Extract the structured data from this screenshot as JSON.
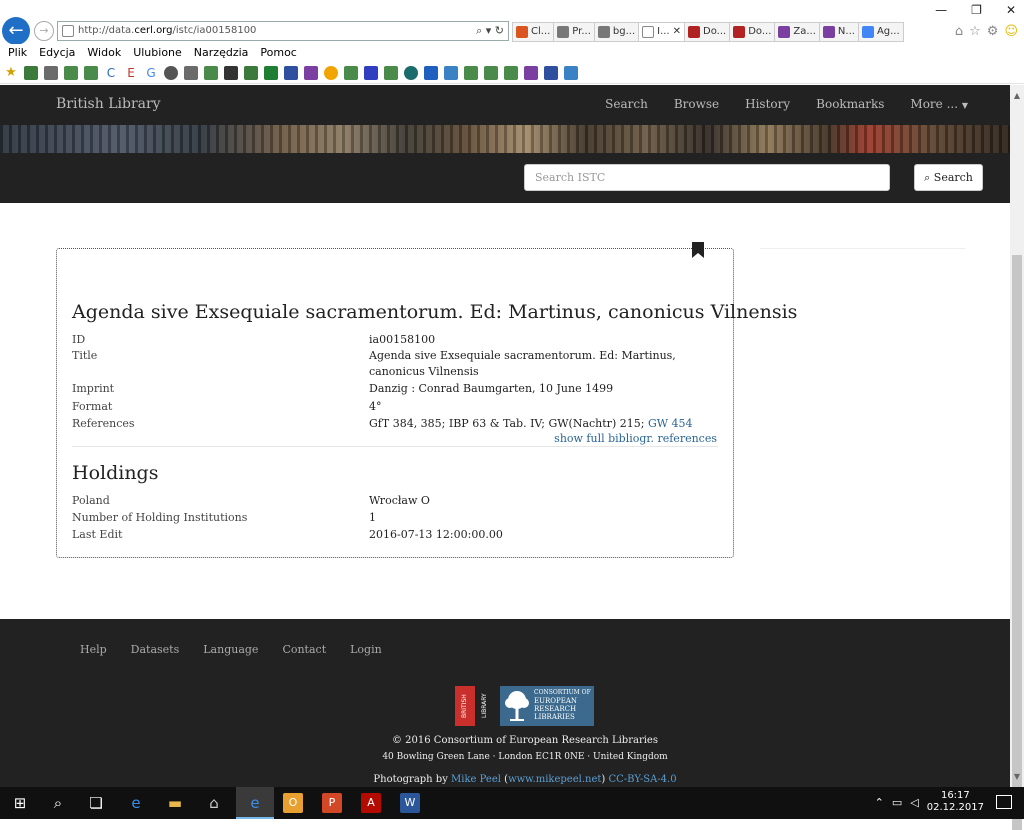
{
  "browser": {
    "url_prefix": "http://data.",
    "url_host": "cerl.org",
    "url_path": "/istc/ia00158100",
    "tabs": [
      {
        "label": "Cl...",
        "color": "#d9541e"
      },
      {
        "label": "Pr...",
        "color": "#777777"
      },
      {
        "label": "bg...",
        "color": "#777777"
      },
      {
        "label": "I...",
        "color": "#888888",
        "active": true
      },
      {
        "label": "Do...",
        "color": "#b22222"
      },
      {
        "label": "Do...",
        "color": "#b22222"
      },
      {
        "label": "Za...",
        "color": "#7a3fa0"
      },
      {
        "label": "N...",
        "color": "#7a3fa0"
      },
      {
        "label": "Ag...",
        "color": "#4285f4"
      }
    ],
    "menu": [
      "Plik",
      "Edycja",
      "Widok",
      "Ulubione",
      "Narzędzia",
      "Pomoc"
    ]
  },
  "site": {
    "brand": "British Library",
    "nav": [
      "Search",
      "Browse",
      "History",
      "Bookmarks",
      "More ..."
    ],
    "search_placeholder": "Search ISTC",
    "search_button": "Search"
  },
  "record": {
    "title": "Agenda sive Exsequiale sacramentorum. Ed: Martinus, canonicus Vilnensis",
    "fields": {
      "id_label": "ID",
      "id_value": "ia00158100",
      "title_label": "Title",
      "title_value": "Agenda sive Exsequiale sacramentorum. Ed: Martinus, canonicus Vilnensis",
      "imprint_label": "Imprint",
      "imprint_value": "Danzig : Conrad Baumgarten, 10 June 1499",
      "format_label": "Format",
      "format_value": "4°",
      "references_label": "References",
      "references_value": "GfT 384, 385; IBP 63 & Tab. IV; GW(Nachtr) 215;",
      "references_link": "GW 454"
    },
    "show_refs": "show full bibliogr. references",
    "holdings_title": "Holdings",
    "holdings": {
      "country_label": "Poland",
      "country_value": "Wrocław O",
      "count_label": "Number of Holding Institutions",
      "count_value": "1",
      "edit_label": "Last Edit",
      "edit_value": "2016-07-13 12:00:00.00"
    }
  },
  "footer": {
    "links": [
      "Help",
      "Datasets",
      "Language",
      "Contact",
      "Login"
    ],
    "bl_logo_text": "BRITISH LIBRARY",
    "cerl_logo_lines": [
      "CONSORTIUM OF",
      "EUROPEAN",
      "RESEARCH",
      "LIBRARIES"
    ],
    "copyright": "© 2016 Consortium of European Research Libraries",
    "address": "40 Bowling Green Lane · London EC1R 0NE · United Kingdom",
    "photo_prefix": "Photograph by",
    "photo_author": "Mike Peel",
    "photo_site": "www.mikepeel.net",
    "photo_license": "CC-BY-SA-4.0"
  },
  "taskbar": {
    "time": "16:17",
    "date": "02.12.2017"
  }
}
